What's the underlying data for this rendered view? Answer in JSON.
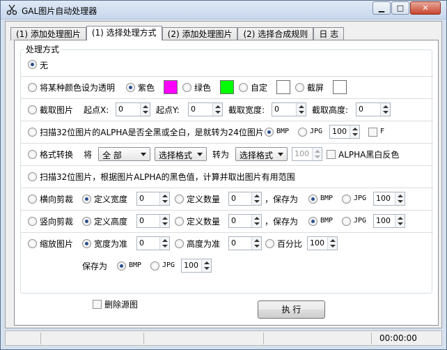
{
  "window": {
    "title": "GAL图片自动处理器",
    "minimize_icon": "minimize-icon",
    "maximize_icon": "maximize-icon",
    "close_icon": "close-icon"
  },
  "tabs": [
    {
      "label": "(1) 添加处理图片",
      "active": false
    },
    {
      "label": "(1) 选择处理方式",
      "active": true
    },
    {
      "label": "(2) 添加处理图片",
      "active": false
    },
    {
      "label": "(2) 选择合成规则",
      "active": false
    },
    {
      "label": "日 志",
      "active": false
    }
  ],
  "group_title": "处理方式",
  "colors": {
    "magenta": "#ff00ff",
    "green": "#00ff00",
    "custom": "#ffffff",
    "screenshot": "#ffffff"
  },
  "rows": {
    "none": {
      "label": "无",
      "selected": true
    },
    "transparent": {
      "label": "将某种颜色设为透明",
      "opt_purple": "紫色",
      "opt_green": "绿色",
      "opt_custom": "自定",
      "opt_screen": "截屏",
      "selected_option": "紫色"
    },
    "crop": {
      "label": "截取图片",
      "start_x_label": "起点X:",
      "start_x": "0",
      "start_y_label": "起点Y:",
      "start_y": "0",
      "width_label": "截取宽度:",
      "width": "0",
      "height_label": "截取高度:",
      "height": "0"
    },
    "scan24": {
      "label": "扫描32位图片的ALPHA是否全黑或全白，是就转为24位图片",
      "bmp": "BMP",
      "jpg": "JPG",
      "quality": "100",
      "f_label": "F",
      "selected_format": "BMP"
    },
    "convert": {
      "label": "格式转换",
      "from_label": "将",
      "from_value": "全 部",
      "fmt_value": "选择格式",
      "to_label": "转为",
      "to_value": "选择格式",
      "quality": "100",
      "invert_label": "ALPHA黑白反色"
    },
    "scanrange": {
      "label": "扫描32位图片，根据图片ALPHA的黑色值，计算并取出图片有用范围"
    },
    "hcut": {
      "label": "横向剪裁",
      "opt_width": "定义宽度",
      "width": "0",
      "opt_count": "定义数量",
      "count": "0",
      "save_label": "，保存为",
      "bmp": "BMP",
      "jpg": "JPG",
      "quality": "100"
    },
    "vcut": {
      "label": "竖向剪裁",
      "opt_height": "定义高度",
      "height": "0",
      "opt_count": "定义数量",
      "count": "0",
      "save_label": "，保存为",
      "bmp": "BMP",
      "jpg": "JPG",
      "quality": "100"
    },
    "scale": {
      "label": "缩放图片",
      "opt_width": "宽度为准",
      "width": "0",
      "opt_height": "高度为准",
      "height": "0",
      "opt_percent": "百分比",
      "percent": "100",
      "save_label": "保存为",
      "bmp": "BMP",
      "jpg": "JPG",
      "quality": "100"
    }
  },
  "delete_source_label": "删除源图",
  "execute_label": "执 行",
  "status_time": "00:00:00"
}
